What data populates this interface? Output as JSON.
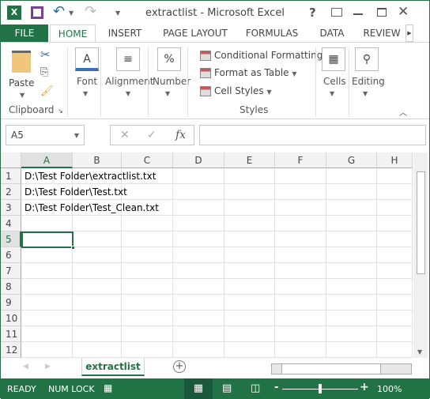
{
  "window": {
    "title": "extractlist - Microsoft Excel"
  },
  "tabs": [
    "FILE",
    "HOME",
    "INSERT",
    "PAGE LAYOUT",
    "FORMULAS",
    "DATA",
    "REVIEW"
  ],
  "ribbon": {
    "clipboard": {
      "paste": "Paste",
      "label": "Clipboard"
    },
    "font": "Font",
    "alignment": "Alignment",
    "number": "Number",
    "styles": {
      "items": [
        "Conditional Formatting",
        "Format as Table",
        "Cell Styles"
      ],
      "label": "Styles"
    },
    "cells": "Cells",
    "editing": "Editing"
  },
  "formula_bar": {
    "name_box": "A5",
    "cancel": "✕",
    "enter": "✓",
    "fx": "fx",
    "value": ""
  },
  "columns": [
    "A",
    "B",
    "C",
    "D",
    "E",
    "F",
    "G",
    "H"
  ],
  "rows": [
    "1",
    "2",
    "3",
    "4",
    "5",
    "6",
    "7",
    "8",
    "9",
    "10",
    "11",
    "12"
  ],
  "cells": {
    "A1": "D:\\Test Folder\\extractlist.txt",
    "A2": "D:\\Test Folder\\Test.txt",
    "A3": "D:\\Test Folder\\Test_Clean.txt"
  },
  "active_cell": "A5",
  "sheets": [
    "extractlist"
  ],
  "status": {
    "ready": "READY",
    "numlock": "NUM LOCK",
    "zoom": "100%",
    "zoom_percent": 100
  },
  "colors": {
    "accent": "#217346"
  }
}
